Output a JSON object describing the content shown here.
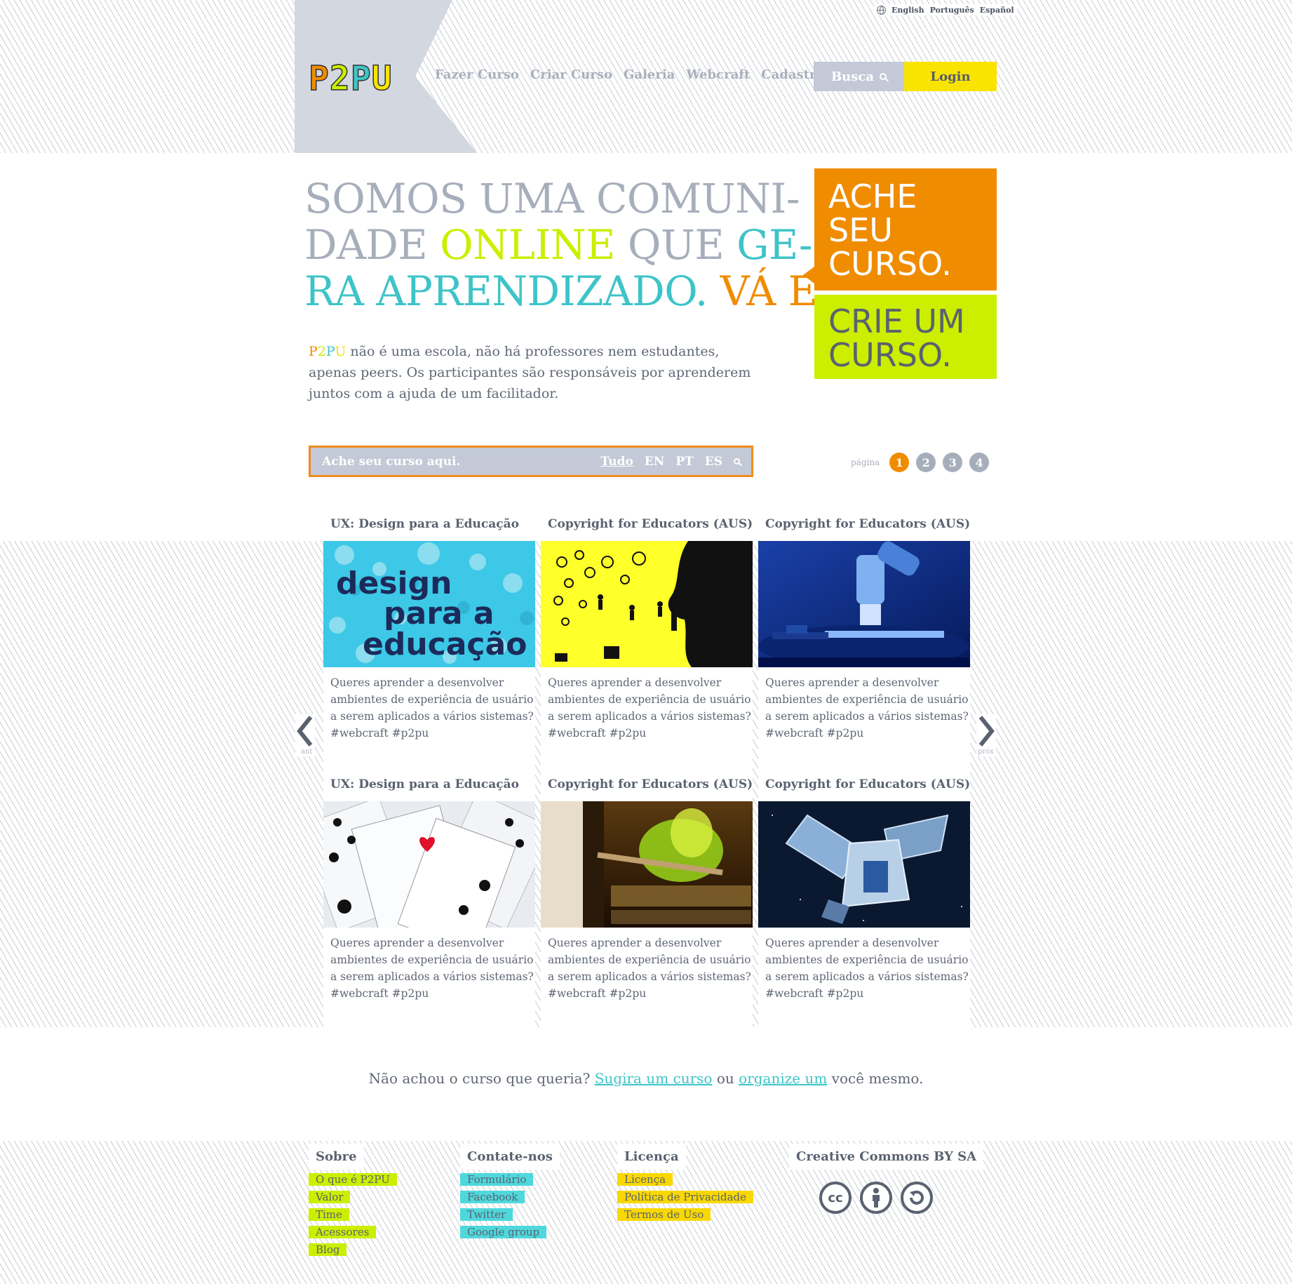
{
  "colors": {
    "orange": "#f08c00",
    "lime": "#ccee00",
    "teal": "#3ec4c8",
    "yellow": "#f8e400",
    "slate": "#5a6270",
    "gray": "#a7aebb"
  },
  "header": {
    "languages": [
      "English",
      "Português",
      "Español"
    ],
    "logo": [
      "P",
      "2",
      "P",
      "U"
    ],
    "nav": [
      "Fazer Curso",
      "Criar Curso",
      "Galeria",
      "Webcraft",
      "Cadastre-se"
    ],
    "search_label": "Busca",
    "login_label": "Login"
  },
  "hero": {
    "line1": "SOMOS UMA COMUNI-",
    "line2a": "DADE ",
    "line2b": "ONLINE",
    "line2c": " QUE ",
    "line2d": "GE-",
    "line3a": "RA APRENDIZADO. ",
    "line3b": "VÁ E",
    "intro_brand_a": "P",
    "intro_brand_b": "2",
    "intro_brand_c": "P",
    "intro_brand_d": "U",
    "intro_text": " não é uma escola, não há professores nem estudantes, apenas peers. Os participantes são responsáveis por aprenderem juntos com a ajuda de um facilitador.",
    "card_find": "ACHE SEU CURSO.",
    "card_create": "CRIE UM CURSO."
  },
  "course_search": {
    "placeholder": "Ache seu curso aqui.",
    "filters": [
      "Tudo",
      "EN",
      "PT",
      "ES"
    ]
  },
  "pager": {
    "label": "página",
    "pages": [
      "1",
      "2",
      "3",
      "4"
    ],
    "current": "1"
  },
  "carousel": {
    "prev_label": "ant",
    "next_label": "próx"
  },
  "courses": [
    {
      "title": "UX: Design para a Educação",
      "image": "design para a educação",
      "description": "Queres aprender a desenvolver ambientes de experiência de usuário a serem aplicados a vários sistemas? #webcraft #p2pu"
    },
    {
      "title": "Copyright for Educators (AUS)",
      "image": "copyright-icons",
      "description": "Queres aprender a desenvolver ambientes de experiência de usuário a serem aplicados a vários sistemas? #webcraft #p2pu"
    },
    {
      "title": "Copyright for Educators (AUS)",
      "image": "microscope",
      "description": "Queres aprender a desenvolver ambientes de experiência de usuário a serem aplicados a vários sistemas? #webcraft #p2pu"
    },
    {
      "title": "UX: Design para a Educação",
      "image": "playing-cards",
      "description": "Queres aprender a desenvolver ambientes de experiência de usuário a serem aplicados a vários sistemas? #webcraft #p2pu"
    },
    {
      "title": "Copyright for Educators (AUS)",
      "image": "kitchen-flames",
      "description": "Queres aprender a desenvolver ambientes de experiência de usuário a serem aplicados a vários sistemas? #webcraft #p2pu"
    },
    {
      "title": "Copyright for Educators (AUS)",
      "image": "satellite",
      "description": "Queres aprender a desenvolver ambientes de experiência de usuário a serem aplicados a vários sistemas? #webcraft #p2pu"
    }
  ],
  "cta": {
    "before": "Não achou o curso que queria?  ",
    "link1": "Sugira um curso",
    "middle": " ou ",
    "link2": "organize um",
    "after": " você mesmo."
  },
  "footer": {
    "sobre": {
      "title": "Sobre",
      "links": [
        "O que é P2PU",
        "Valor",
        "Time",
        "Acessores",
        "Blog"
      ]
    },
    "contato": {
      "title": "Contate-nos",
      "links": [
        "Formulário",
        "Facebook",
        "Twitter",
        "Google group"
      ]
    },
    "licenca": {
      "title": "Licença",
      "links": [
        "Licença",
        "Política de Privacidade",
        "Termos de Uso"
      ]
    },
    "cc": {
      "title": "Creative Commons BY SA",
      "icons": [
        "cc-icon",
        "attribution-icon",
        "share-alike-icon"
      ]
    }
  }
}
